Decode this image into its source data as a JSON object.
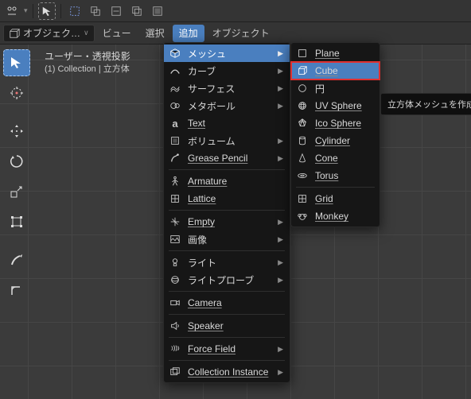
{
  "header": {
    "object_dropdown": "オブジェク…",
    "view": "ビュー",
    "select": "選択",
    "add": "追加",
    "object": "オブジェクト"
  },
  "viewport_info": {
    "line1": "ユーザー・透視投影",
    "line2": "(1) Collection | 立方体"
  },
  "add_menu": {
    "mesh": "メッシュ",
    "curve": "カーブ",
    "surface": "サーフェス",
    "metaball": "メタボール",
    "text": "Text",
    "volume": "ボリューム",
    "grease_pencil": "Grease Pencil",
    "armature": "Armature",
    "lattice": "Lattice",
    "empty": "Empty",
    "image": "画像",
    "light": "ライト",
    "light_probe": "ライトプローブ",
    "camera": "Camera",
    "speaker": "Speaker",
    "force_field": "Force Field",
    "collection_instance": "Collection Instance"
  },
  "mesh_menu": {
    "plane": "Plane",
    "cube": "Cube",
    "circle": "円",
    "uv_sphere": "UV Sphere",
    "ico_sphere": "Ico Sphere",
    "cylinder": "Cylinder",
    "cone": "Cone",
    "torus": "Torus",
    "grid": "Grid",
    "monkey": "Monkey"
  },
  "tooltip": "立方体メッシュを作成します."
}
